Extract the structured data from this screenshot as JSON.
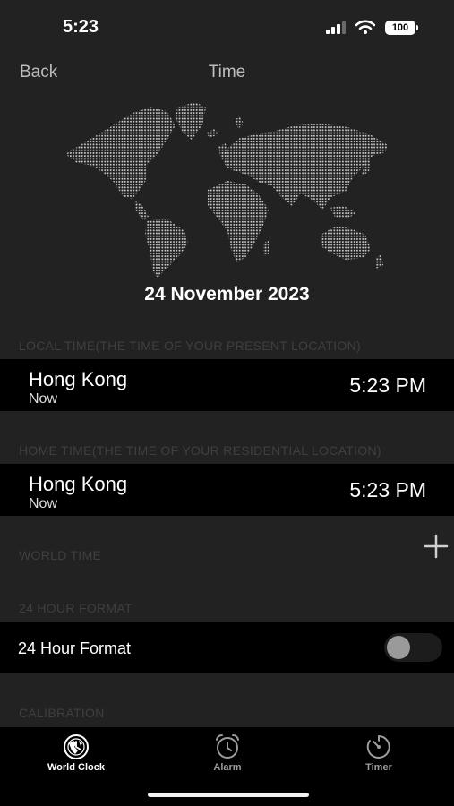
{
  "status": {
    "time": "5:23",
    "battery": "100"
  },
  "nav": {
    "back": "Back",
    "title": "Time"
  },
  "date": "24 November 2023",
  "local": {
    "header": "LOCAL TIME(THE TIME OF YOUR PRESENT LOCATION)",
    "city": "Hong Kong",
    "sub": "Now",
    "time": "5:23 PM"
  },
  "home": {
    "header": "HOME TIME(THE TIME OF YOUR RESIDENTIAL LOCATION)",
    "city": "Hong Kong",
    "sub": "Now",
    "time": "5:23 PM"
  },
  "world": {
    "header": "WORLD TIME"
  },
  "format": {
    "header": "24 HOUR FORMAT",
    "label": "24 Hour Format",
    "enabled": false
  },
  "calibration": {
    "header": "CALIBRATION"
  },
  "tabs": [
    {
      "label": "World Clock",
      "icon": "globe-icon",
      "active": true
    },
    {
      "label": "Alarm",
      "icon": "alarm-clock-icon",
      "active": false
    },
    {
      "label": "Timer",
      "icon": "timer-icon",
      "active": false
    }
  ],
  "colors": {
    "background": "#222222",
    "row": "#000000",
    "section_text": "#3f3f3f",
    "map_dots": "#c8c8c8"
  }
}
